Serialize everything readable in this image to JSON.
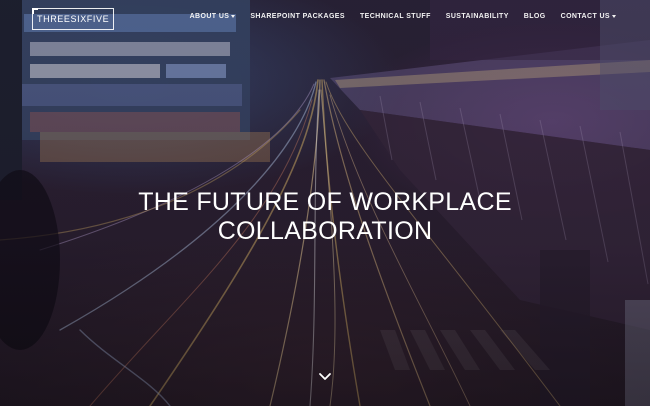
{
  "brand": {
    "logo_text": "THREESIXFIVE"
  },
  "nav": {
    "items": [
      {
        "label": "ABOUT US",
        "dropdown": true
      },
      {
        "label": "SHAREPOINT PACKAGES",
        "dropdown": false
      },
      {
        "label": "TECHNICAL STUFF",
        "dropdown": false
      },
      {
        "label": "SUSTAINABILITY",
        "dropdown": false
      },
      {
        "label": "BLOG",
        "dropdown": false
      },
      {
        "label": "CONTACT US",
        "dropdown": true
      }
    ]
  },
  "hero": {
    "headline_line1": "THE FUTURE OF WORKPLACE",
    "headline_line2": "COLLABORATION",
    "scroll_icon": "chevron-down-icon"
  },
  "colors": {
    "text": "#ffffff",
    "overlay": "#2a1f33",
    "light_trail_warm": "#f0c870",
    "light_trail_cool": "#c8e0ff"
  }
}
